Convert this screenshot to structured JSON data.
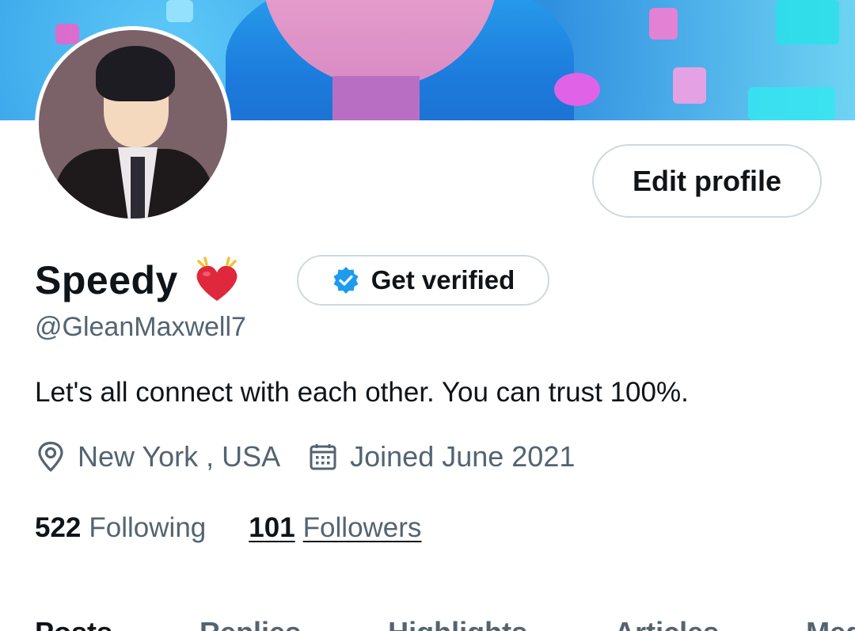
{
  "profile": {
    "name": "Speedy",
    "handle": "@GleanMaxwell7",
    "bio": "Let's all connect with each other. You can trust 100%.",
    "location": "New York , USA",
    "joined": "Joined June 2021",
    "following_count": "522",
    "following_label": "Following",
    "followers_count": "101",
    "followers_label": "Followers"
  },
  "buttons": {
    "edit_profile": "Edit profile",
    "get_verified": "Get verified"
  },
  "tabs": [
    "Posts",
    "Replies",
    "Highlights",
    "Articles",
    "Media"
  ],
  "icons": {
    "location": "location-pin-icon",
    "calendar": "calendar-icon",
    "verified": "verified-badge-icon",
    "emoji": "beating-heart-emoji-icon"
  },
  "colors": {
    "text_primary": "#0f1419",
    "text_secondary": "#536471",
    "border": "#cfd9de",
    "verified_blue": "#1d9bf0",
    "heart_red": "#e0283c"
  }
}
